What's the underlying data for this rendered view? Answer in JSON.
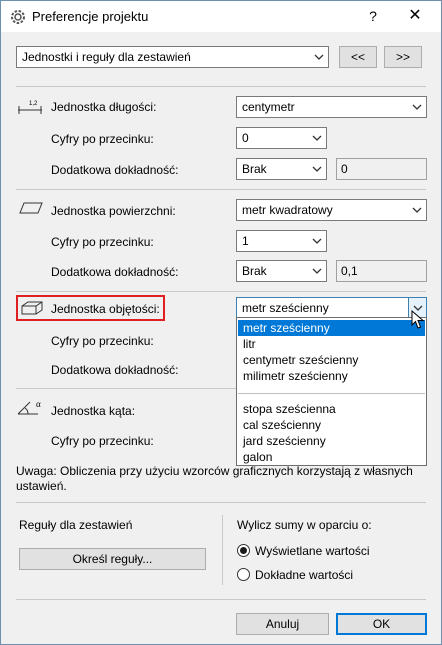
{
  "window": {
    "title": "Preferencje projektu",
    "help_label": "?",
    "close_label": "✕"
  },
  "top": {
    "section_select": "Jednostki i reguły dla zestawień",
    "prev_label": "<<",
    "next_label": ">>"
  },
  "length": {
    "icon_text": "1,2",
    "unit_label": "Jednostka długości:",
    "unit_value": "centymetr",
    "decimals_label": "Cyfry po przecinku:",
    "decimals_value": "0",
    "extra_label": "Dodatkowa dokładność:",
    "extra_value": "Brak",
    "extra_field": "0"
  },
  "area": {
    "unit_label": "Jednostka powierzchni:",
    "unit_value": "metr kwadratowy",
    "decimals_label": "Cyfry po przecinku:",
    "decimals_value": "1",
    "extra_label": "Dodatkowa dokładność:",
    "extra_value": "Brak",
    "extra_field": "0,1"
  },
  "volume": {
    "unit_label": "Jednostka objętości:",
    "unit_value": "metr sześcienny",
    "decimals_label": "Cyfry po przecinku:",
    "extra_label": "Dodatkowa dokładność:",
    "options_group1": [
      "metr sześcienny",
      "litr",
      "centymetr sześcienny",
      "milimetr sześcienny"
    ],
    "options_group2": [
      "stopa sześcienna",
      "cal sześcienny",
      "jard sześcienny",
      "galon"
    ],
    "selected_index": 0
  },
  "angle": {
    "icon_text": "α",
    "unit_label": "Jednostka kąta:",
    "decimals_label": "Cyfry po przecinku:"
  },
  "note": {
    "text": "Uwaga: Obliczenia przy użyciu wzorców graficznych korzystają z własnych ustawień."
  },
  "rules": {
    "heading": "Reguły dla zestawień",
    "define_button": "Określ reguły..."
  },
  "sums": {
    "heading": "Wylicz sumy w oparciu o:",
    "option_displayed": "Wyświetlane wartości",
    "option_exact": "Dokładne wartości",
    "selected": "Wyświetlane wartości"
  },
  "footer": {
    "cancel_label": "Anuluj",
    "ok_label": "OK"
  },
  "colors": {
    "highlight": "#e02020",
    "selection": "#0078d7",
    "default_button_border": "#0078d7"
  }
}
